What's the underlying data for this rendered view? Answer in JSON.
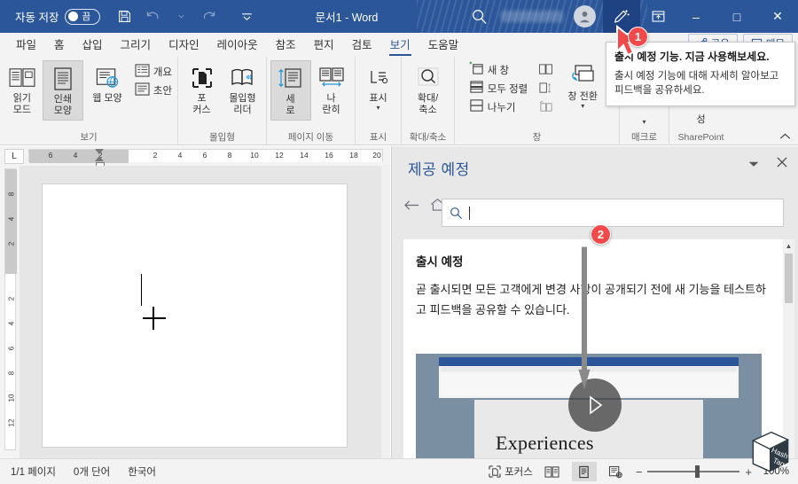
{
  "titlebar": {
    "autosave_label": "자동 저장",
    "autosave_state": "끔",
    "doc_title": "문서1  -  Word",
    "icons": {
      "save": "save-icon",
      "undo": "undo-icon",
      "redo": "redo-icon",
      "more": "quick-access-more-icon",
      "search": "search-icon",
      "account": "account-avatar-icon",
      "upcoming": "upcoming-features-pen-icon",
      "ribbon_display": "ribbon-display-options-icon"
    },
    "window": {
      "minimize": "–",
      "maximize": "□",
      "close": "✕"
    }
  },
  "tabs": [
    {
      "label": "파일",
      "active": false
    },
    {
      "label": "홈",
      "active": false
    },
    {
      "label": "삽입",
      "active": false
    },
    {
      "label": "그리기",
      "active": false
    },
    {
      "label": "디자인",
      "active": false
    },
    {
      "label": "레이아웃",
      "active": false
    },
    {
      "label": "참조",
      "active": false
    },
    {
      "label": "편지",
      "active": false
    },
    {
      "label": "검토",
      "active": false
    },
    {
      "label": "보기",
      "active": true
    },
    {
      "label": "도움말",
      "active": false
    }
  ],
  "ribbon": {
    "groups": [
      {
        "label": "보기",
        "big": [
          {
            "line1": "읽기",
            "line2": "모드",
            "selected": false
          },
          {
            "line1": "인쇄",
            "line2": "모양",
            "selected": true
          },
          {
            "line1": "웹 모양",
            "line2": "",
            "selected": false
          }
        ],
        "small": [
          {
            "label": "개요"
          },
          {
            "label": "초안"
          }
        ]
      },
      {
        "label": "몰입형",
        "big": [
          {
            "line1": "포",
            "line2": "커스",
            "selected": false
          },
          {
            "line1": "몰입형",
            "line2": "리더",
            "selected": false
          }
        ],
        "small": []
      },
      {
        "label": "페이지 이동",
        "big": [
          {
            "line1": "세",
            "line2": "로",
            "selected": true
          },
          {
            "line1": "나",
            "line2": "란히",
            "selected": false
          }
        ],
        "small": []
      },
      {
        "label": "표시",
        "big": [
          {
            "line1": "표시",
            "line2": "",
            "selected": false
          }
        ],
        "small": []
      },
      {
        "label": "확대/축소",
        "big": [
          {
            "line1": "확대/",
            "line2": "축소",
            "selected": false
          }
        ],
        "small": []
      },
      {
        "label": "창",
        "small": [
          {
            "label": "새 창"
          },
          {
            "label": "모두 정렬"
          },
          {
            "label": "나누기"
          }
        ],
        "small2": [
          {
            "label": ""
          },
          {
            "label": ""
          },
          {
            "label": ""
          }
        ],
        "switch_label_1": "창 전환",
        "big": []
      },
      {
        "label": "매크로",
        "big": [
          {
            "line1": "",
            "line2": "",
            "selected": false
          }
        ],
        "small": []
      },
      {
        "label": "SharePoint",
        "top_label": "성",
        "big": [],
        "small": []
      }
    ],
    "collapse_icon": "collapse-ribbon-chevron-icon"
  },
  "share": {
    "share_label": "공유",
    "comments_label": "메모"
  },
  "tooltip": {
    "title": "출시 예정 기능. 지금 사용해보세요.",
    "body": "출시 예정 기능에 대해 자세히 알아보고 피드백을 공유하세요."
  },
  "ruler": {
    "tabstop_glyph": "L",
    "h_numbers_margin": [
      6,
      4,
      2
    ],
    "h_numbers": [
      2,
      4,
      6,
      8,
      10,
      12,
      14,
      16,
      18,
      20
    ],
    "v_numbers_margin": [
      8,
      4,
      2
    ],
    "v_numbers": [
      2,
      4,
      6,
      8,
      10,
      12
    ]
  },
  "pane": {
    "title": "제공 예정",
    "dropdown_icon": "chevron-down-icon",
    "close_icon": "close-icon",
    "back_icon": "back-arrow-icon",
    "home_icon": "home-icon",
    "search_placeholder": "",
    "search_value": "",
    "content": {
      "heading": "출시 예정",
      "body": "곧 출시되면 모든 고객에게 변경 사항이 공개되기 전에 새 기능을 테스트하고 피드백을 공유할 수 있습니다.",
      "video_caption": "Experiences",
      "play_icon": "play-button-icon"
    }
  },
  "annotations": {
    "badge1": "1",
    "badge2": "2"
  },
  "statusbar": {
    "page_info": "1/1 페이지",
    "word_count": "0개 단어",
    "language": "한국어",
    "focus_label": "포커스",
    "views": [
      {
        "name": "read-mode-view-button",
        "selected": false
      },
      {
        "name": "print-layout-view-button",
        "selected": true
      },
      {
        "name": "web-layout-view-button",
        "selected": false
      }
    ],
    "zoom_out": "−",
    "zoom_in": "+",
    "zoom_level": "100%"
  },
  "watermark": {
    "line1": "Hash",
    "line2": "Tag"
  },
  "colors": {
    "word_blue": "#2b579a",
    "accent_red": "#f24a4a",
    "ribbon_bg": "#f3f3f3"
  }
}
